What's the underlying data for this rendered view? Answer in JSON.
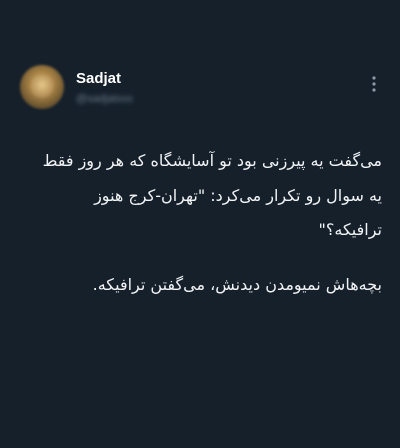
{
  "author": {
    "display_name": "Sadjat",
    "handle": "@sadjatxxx"
  },
  "tweet": {
    "lines": [
      "می‌گفت یه پیرزنی بود تو آسایشگاه که هر روز فقط",
      "یه سوال رو تکرار می‌کرد: \"تهران-کرج هنوز",
      "ترافیکه؟\"",
      "بچه‌هاش نمیومدن دیدنش، می‌گفتن ترافیکه."
    ]
  },
  "icons": {
    "more": "more-vertical-icon",
    "avatar": "blurred-avatar"
  },
  "colors": {
    "background": "#15202b",
    "text": "#f1f3f5",
    "secondary_text": "#6e7b88"
  }
}
